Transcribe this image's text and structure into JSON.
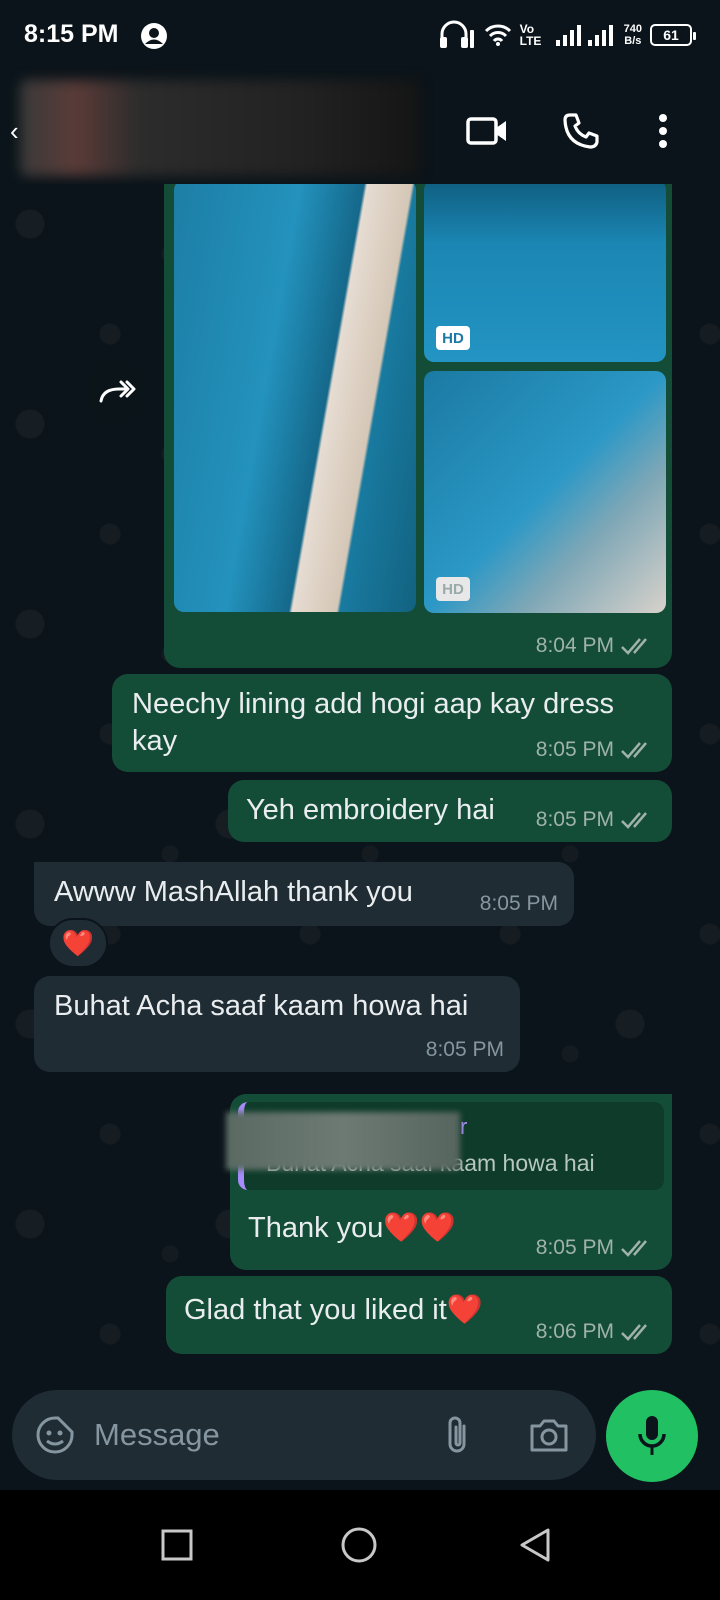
{
  "status_bar": {
    "time": "8:15 PM",
    "network": "Vo LTE",
    "speed_value": "740",
    "speed_unit": "B/s",
    "battery": "61"
  },
  "messages": {
    "image_message": {
      "time": "8:04 PM",
      "badge_top": "HD",
      "badge_bottom": "HD"
    },
    "m1": {
      "text": "Neechy lining add hogi aap kay dress kay",
      "time": "8:05 PM"
    },
    "m2": {
      "text": "Yeh embroidery hai",
      "time": "8:05 PM"
    },
    "m3": {
      "text": "Awww MashAllah thank you",
      "time": "8:05 PM",
      "reaction": "❤️"
    },
    "m4": {
      "text": "Buhat Acha saaf kaam howa hai",
      "time": "8:05 PM"
    },
    "m5": {
      "quote_name_visible": "r",
      "quote_text": "Buhat Acha saaf kaam howa hai",
      "text": "Thank you❤️❤️",
      "time": "8:05 PM"
    },
    "m6": {
      "text": "Glad that you liked it❤️",
      "time": "8:06 PM"
    }
  },
  "input": {
    "placeholder": "Message"
  },
  "colors": {
    "outgoing_bubble": "#144d37",
    "incoming_bubble": "#1f2c34",
    "accent": "#21c063",
    "read_tick": "#9fb2ac"
  },
  "icons": [
    "person-status-icon",
    "headphones-icon",
    "wifi-icon",
    "signal-icon",
    "battery-icon",
    "back-icon",
    "video-call-icon",
    "voice-call-icon",
    "more-options-icon",
    "forward-icon",
    "read-ticks-icon",
    "sticker-icon",
    "attach-icon",
    "camera-icon",
    "mic-icon",
    "recent-apps-icon",
    "home-icon",
    "back-nav-icon"
  ]
}
